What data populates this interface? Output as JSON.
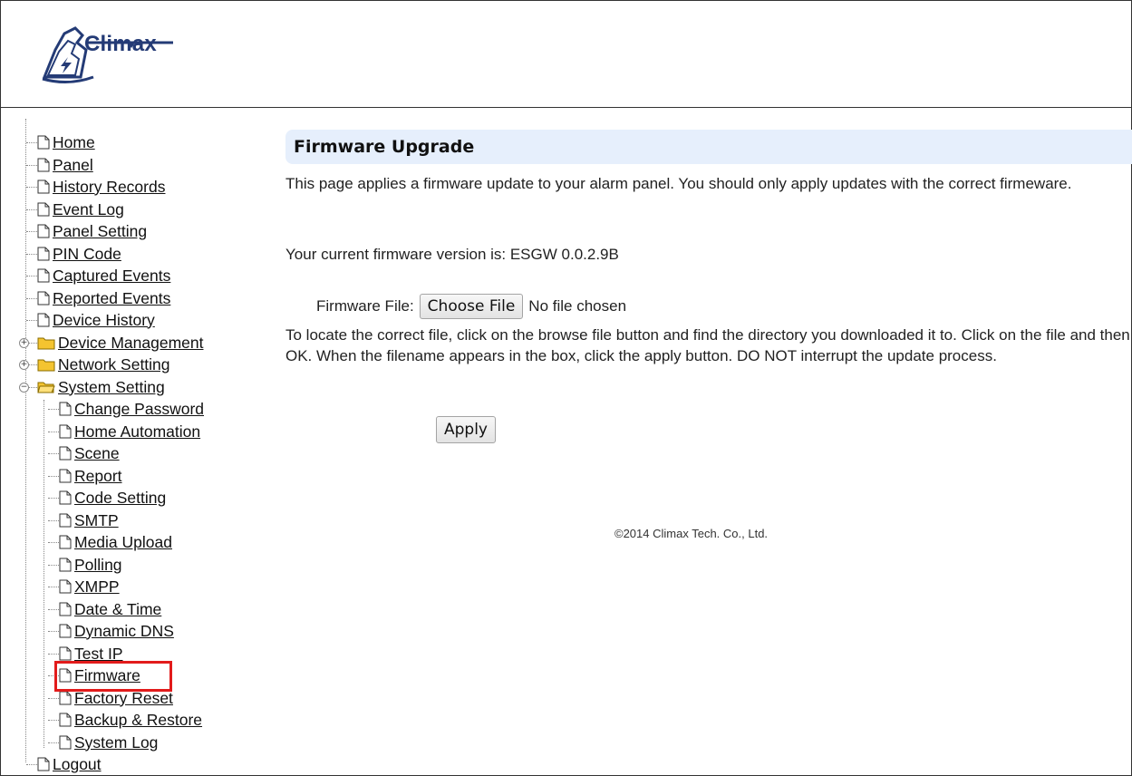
{
  "header": {
    "logo_text": "Climax"
  },
  "sidebar": {
    "items": [
      {
        "label": "Home",
        "icon": "page-icon"
      },
      {
        "label": "Panel",
        "icon": "page-icon"
      },
      {
        "label": "History Records",
        "icon": "page-icon"
      },
      {
        "label": "Event Log",
        "icon": "page-icon"
      },
      {
        "label": "Panel Setting",
        "icon": "page-icon"
      },
      {
        "label": "PIN Code",
        "icon": "page-icon"
      },
      {
        "label": "Captured Events",
        "icon": "page-icon"
      },
      {
        "label": "Reported Events",
        "icon": "page-icon"
      },
      {
        "label": "Device History",
        "icon": "page-icon"
      },
      {
        "label": "Device Management",
        "icon": "folder-icon",
        "expander": "+"
      },
      {
        "label": "Network Setting",
        "icon": "folder-icon",
        "expander": "+"
      },
      {
        "label": "System Setting",
        "icon": "folder-open-icon",
        "expander": "−"
      },
      {
        "label": "Logout",
        "icon": "page-icon"
      }
    ],
    "system_setting_children": [
      {
        "label": "Change Password"
      },
      {
        "label": "Home Automation"
      },
      {
        "label": "Scene"
      },
      {
        "label": "Report"
      },
      {
        "label": "Code Setting"
      },
      {
        "label": "SMTP"
      },
      {
        "label": "Media Upload"
      },
      {
        "label": "Polling"
      },
      {
        "label": "XMPP"
      },
      {
        "label": "Date & Time"
      },
      {
        "label": "Dynamic DNS"
      },
      {
        "label": "Test IP"
      },
      {
        "label": "Firmware",
        "highlighted": true
      },
      {
        "label": "Factory Reset"
      },
      {
        "label": "Backup & Restore"
      },
      {
        "label": "System Log"
      }
    ]
  },
  "main": {
    "title": "Firmware Upgrade",
    "intro": "This page applies a firmware update to your alarm panel. You should only apply updates with the correct firmeware.",
    "version_line": "Your current firmware version is: ESGW 0.0.2.9B",
    "file_label": "Firmware File:",
    "choose_file_button": "Choose File",
    "no_file_text": "No file chosen",
    "help_text": "To locate the correct file, click on the browse file button and find the directory you downloaded it to. Click on the file and then OK. When the filename appears in the box, click the apply button. DO NOT interrupt the update process.",
    "apply_button": "Apply",
    "copyright": "©2014 Climax Tech. Co., Ltd."
  },
  "colors": {
    "title_bar_bg": "#e6effc",
    "highlight_border": "#e21b1b",
    "logo_blue": "#243b76",
    "folder_yellow": "#f4c430"
  }
}
